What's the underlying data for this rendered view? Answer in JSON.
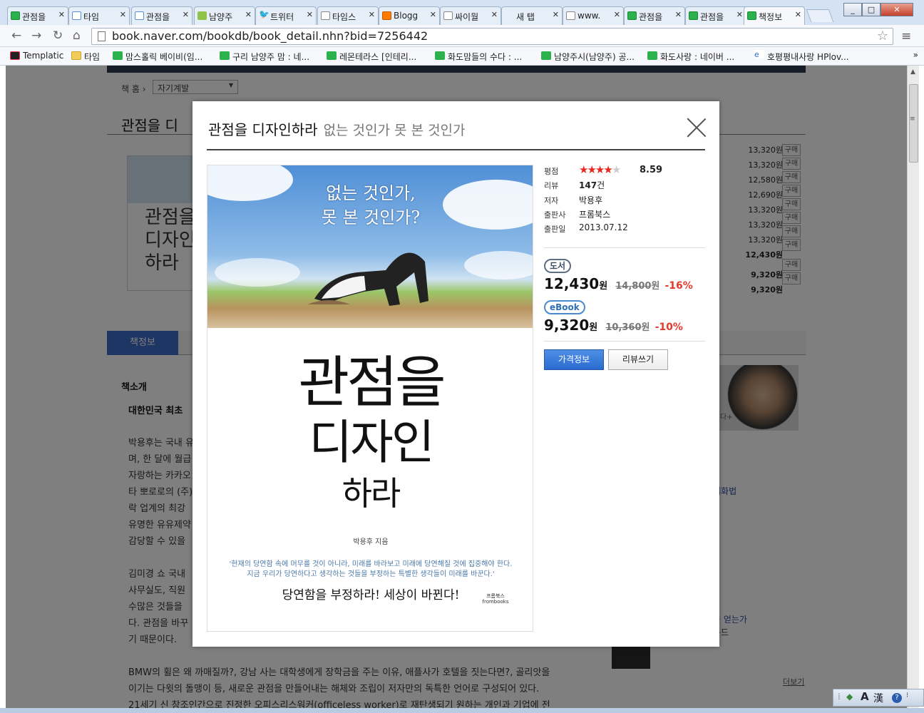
{
  "browser": {
    "tabs": [
      {
        "label": "관점을",
        "icon": "naver"
      },
      {
        "label": "타임",
        "icon": "daum"
      },
      {
        "label": "관점을",
        "icon": "daum"
      },
      {
        "label": "남양주",
        "icon": "lime"
      },
      {
        "label": "트위터",
        "icon": "tw"
      },
      {
        "label": "타임스",
        "icon": "doc"
      },
      {
        "label": "Blogg",
        "icon": "blog"
      },
      {
        "label": "싸이월",
        "icon": "doc"
      },
      {
        "label": "새 탭",
        "icon": "none"
      },
      {
        "label": "www.",
        "icon": "doc"
      },
      {
        "label": "관점을",
        "icon": "naver"
      },
      {
        "label": "관점을",
        "icon": "naver"
      },
      {
        "label": "책정보",
        "icon": "naver"
      }
    ],
    "url": "book.naver.com/bookdb/book_detail.nhn?bid=7256442",
    "bookmarks": [
      {
        "label": "Templatic",
        "icon": "tmpl"
      },
      {
        "label": "타임",
        "icon": "folder"
      },
      {
        "label": "맘스홀릭 베이비(임...",
        "icon": "naver"
      },
      {
        "label": "구리 남양주 맘 : 네...",
        "icon": "naver"
      },
      {
        "label": "레몬테라스 [인테리...",
        "icon": "naver"
      },
      {
        "label": "화도맘들의 수다 : ...",
        "icon": "naver"
      },
      {
        "label": "남양주시(남양주) 공...",
        "icon": "naver"
      },
      {
        "label": "화도사랑 : 네이버 ...",
        "icon": "naver"
      },
      {
        "label": "호평평내사랑 HPlov...",
        "icon": "ie"
      }
    ],
    "bookmarks_more": "»"
  },
  "bg_page": {
    "crumb_home": "책 홈",
    "category": "자기계발",
    "title_partial": "관점을 디",
    "cover_text": "관점을 디자인 하라",
    "prices": [
      "13,320원",
      "13,320원",
      "12,580원",
      "12,690원",
      "13,320원",
      "13,320원",
      "13,320원",
      "12,430원"
    ],
    "prices2": [
      "9,320원",
      "9,320원"
    ],
    "buy_label": "구매",
    "tab_active": "책정보",
    "section_title": "책소개",
    "headline": "대한민국 최초",
    "paragraphs": [
      "박용후는 국내 유",
      "며, 한 달에 월급",
      "자랑하는 카카오",
      "타 뽀로로의 (주)",
      "락 업계의 최강",
      "유명한 유유제약",
      "감당할 수 있을",
      "",
      "김미경 쇼 국내",
      "사무실도, 직원",
      "수많은 것들을",
      "다. 관점을 바꾸",
      "기 때문이다.",
      "",
      "BMW의 휠은 왜 까매질까?, 강남 사는 대학생에게 장학금을 주는 이유, 애플사가 호텔을 짓는다면?, 골리앗을",
      "이기는 다윗의 돌맹이 등, 새로운 관점을 만들어내는 해체와 조립이 저자만의 독특한 언어로 구성되어 있다.",
      "21세기 신 창조인간으로 진정한 오피스리스워커(officeless worker)로 재탄생되기 원하는 개인과 기업에 전"
    ],
    "side_links": [
      "대화법",
      "을 얻는가",
      "몬드"
    ],
    "side_tiny": "다+",
    "more_link": "더보기"
  },
  "modal": {
    "title": "관점을 디자인하라",
    "subtitle": "없는 것인가 못 본 것인가",
    "cover": {
      "subtitle_line1": "없는 것인가,",
      "subtitle_line2": "못 본 것인가?",
      "title_line1": "관점을",
      "title_line2": "디자인",
      "title_line3": "하라",
      "author": "박용후 지음",
      "quote_line1": "'현재의 당연함 속에 머무를 것이 아니라, 미래를 바라보고 미래에 당연해질 것에 집중해야 한다.",
      "quote_line2": "지금 우리가 당연하다고 생각하는 것들을 부정하는 특별한 생각들이 미래를 바꾼다.'",
      "slogan": "당연함을 부정하라! 세상이 바뀐다!",
      "publisher": "프롬북스 frombooks"
    },
    "info": {
      "rating_label": "평점",
      "rating": 8.59,
      "rating_text": "8.59",
      "review_label": "리뷰",
      "review_count": "147",
      "review_unit": "건",
      "author_label": "저자",
      "author": "박용후",
      "publisher_label": "출판사",
      "publisher": "프롬북스",
      "date_label": "출판일",
      "date": "2013.07.12"
    },
    "book_badge": "도서",
    "book_price": "12,430",
    "book_price_unit": "원",
    "book_orig": "14,800",
    "book_orig_unit": "원",
    "book_discount": "-16%",
    "ebook_badge": "eBook",
    "ebook_price": "9,320",
    "ebook_price_unit": "원",
    "ebook_orig": "10,360",
    "ebook_orig_unit": "원",
    "ebook_discount": "-10%",
    "price_button": "가격정보",
    "review_button": "리뷰쓰기"
  },
  "tray": {
    "ime_a": "A",
    "ime_han": "漢",
    "help": "?"
  },
  "colors": {
    "accent": "#2a6bd0",
    "discount": "#e23b2c",
    "stars": "#e8281e",
    "naver": "#2bb24c"
  }
}
